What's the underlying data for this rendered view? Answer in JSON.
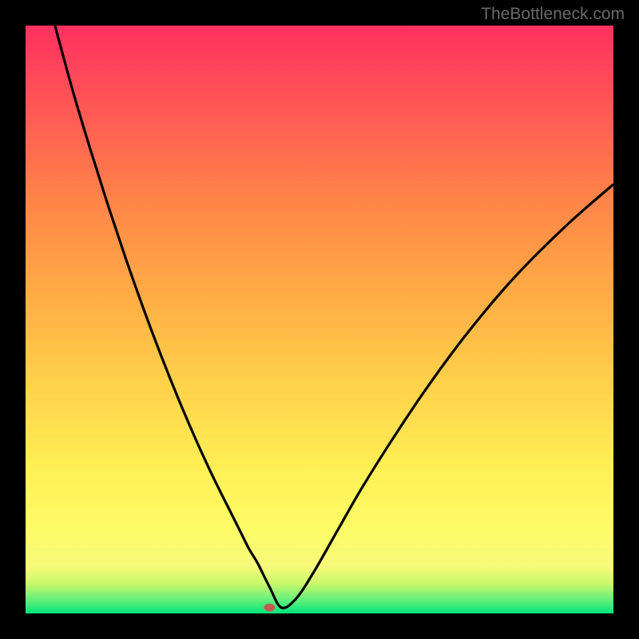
{
  "watermark": "TheBottleneck.com",
  "chart_data": {
    "type": "line",
    "title": "",
    "xlabel": "",
    "ylabel": "",
    "xlim": [
      0,
      100
    ],
    "ylim": [
      0,
      100
    ],
    "gradient_stops": [
      {
        "offset": 0.0,
        "color": "#00e67a"
      },
      {
        "offset": 0.025,
        "color": "#6bf07a"
      },
      {
        "offset": 0.05,
        "color": "#c8f86a"
      },
      {
        "offset": 0.08,
        "color": "#f7fa7a"
      },
      {
        "offset": 0.15,
        "color": "#fffb66"
      },
      {
        "offset": 0.25,
        "color": "#ffef55"
      },
      {
        "offset": 0.4,
        "color": "#ffcf4a"
      },
      {
        "offset": 0.55,
        "color": "#ffaa45"
      },
      {
        "offset": 0.7,
        "color": "#ff8548"
      },
      {
        "offset": 0.85,
        "color": "#ff5a55"
      },
      {
        "offset": 1.0,
        "color": "#ff3060"
      }
    ],
    "series": [
      {
        "name": "bottleneck-curve",
        "stroke": "#000000",
        "x": [
          5.0,
          8,
          11,
          14,
          17,
          20,
          23,
          26,
          29,
          32,
          35,
          36.5,
          38,
          39.5,
          41.5,
          43.5,
          46,
          49,
          53,
          57,
          62,
          68,
          75,
          83,
          92,
          100
        ],
        "y": [
          100,
          89,
          79,
          69.5,
          60.5,
          52,
          44,
          36.5,
          29.5,
          23,
          17,
          14,
          11,
          8.5,
          4.5,
          1.0,
          2.5,
          7,
          14,
          21,
          29,
          38,
          47.5,
          57,
          66,
          73
        ]
      }
    ],
    "marker": {
      "x": 41.5,
      "y": 1.0,
      "color": "#c25a52"
    }
  }
}
